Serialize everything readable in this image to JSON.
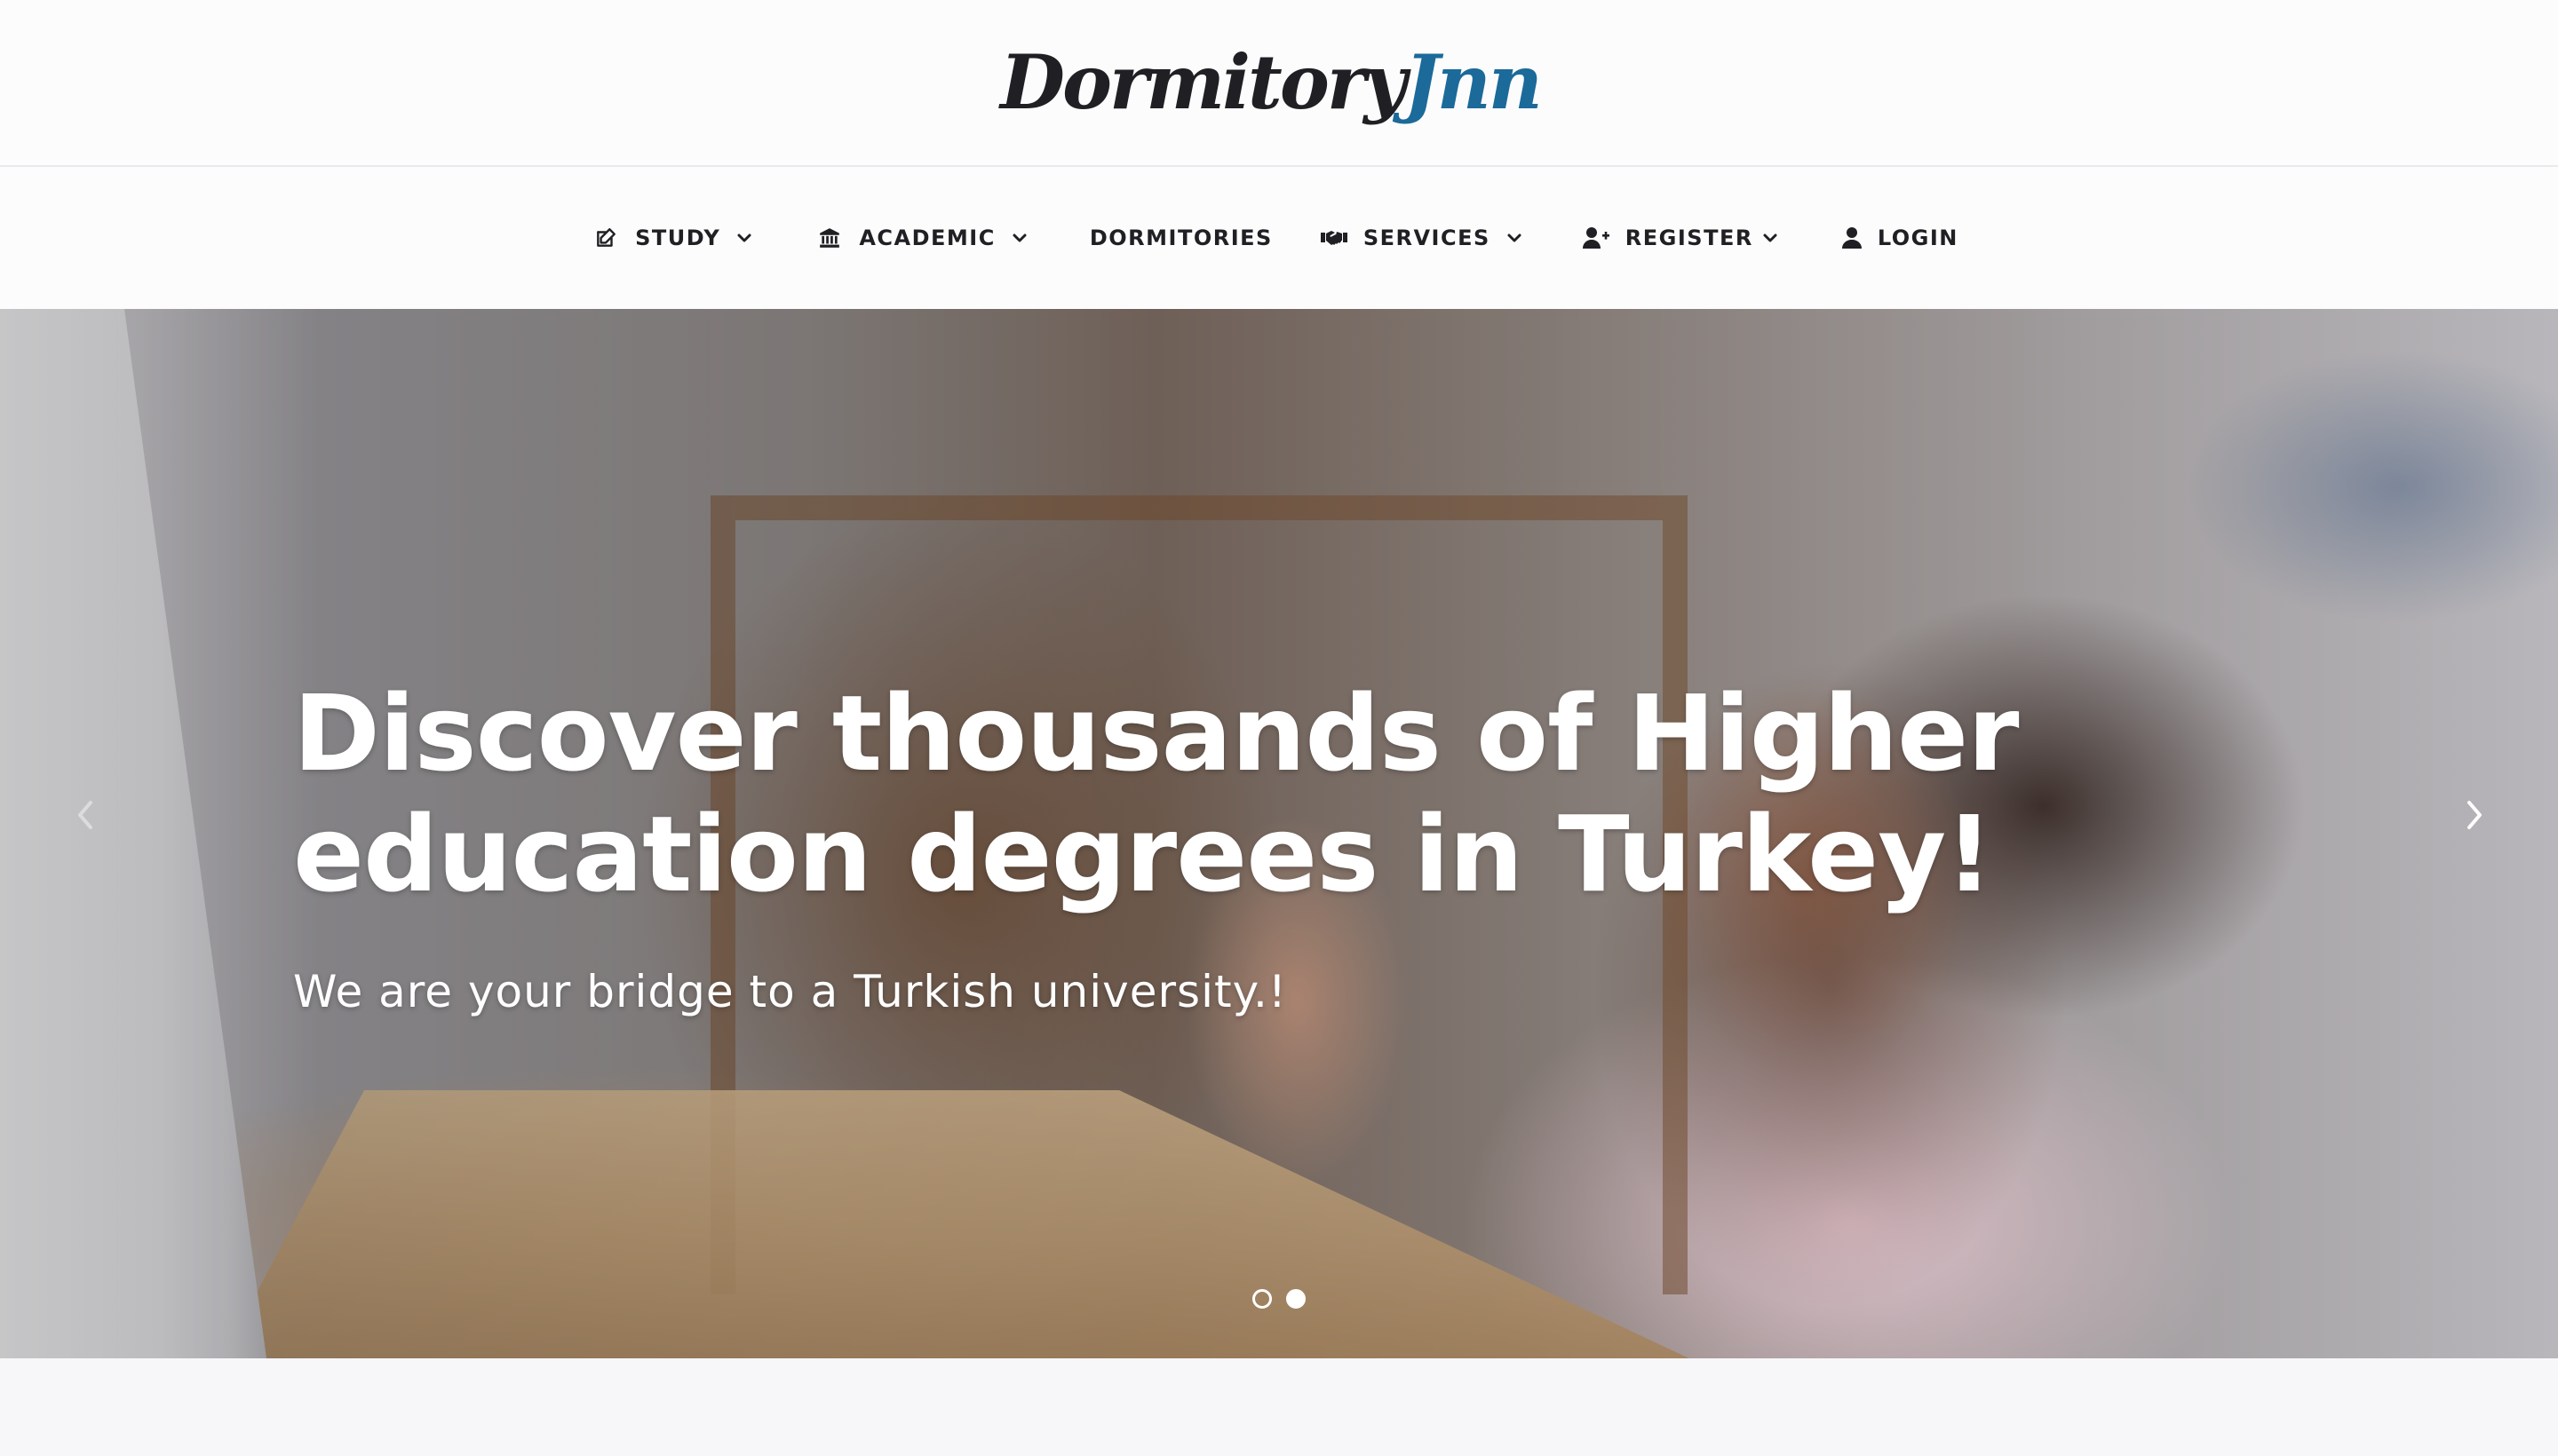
{
  "brand": {
    "logo_part1": "Dormitory",
    "logo_part2": "Jnn",
    "colors": {
      "dark": "#1f1f24",
      "accent": "#1b6a9a"
    }
  },
  "nav": {
    "items": [
      {
        "label": "STUDY",
        "icon": "edit-icon",
        "has_dropdown": true
      },
      {
        "label": "ACADEMIC",
        "icon": "institution-icon",
        "has_dropdown": true
      },
      {
        "label": "DORMITORIES",
        "icon": null,
        "has_dropdown": false
      },
      {
        "label": "SERVICES",
        "icon": "handshake-icon",
        "has_dropdown": true
      },
      {
        "label": "REGISTER",
        "icon": "user-plus-icon",
        "has_dropdown": true
      },
      {
        "label": "LOGIN",
        "icon": "user-icon",
        "has_dropdown": false
      }
    ]
  },
  "hero": {
    "title": "Discover thousands of Higher education degrees in Turkey!",
    "subtitle": "We are your bridge to a Turkish university.!",
    "slides_total": 2,
    "active_slide": 2
  }
}
